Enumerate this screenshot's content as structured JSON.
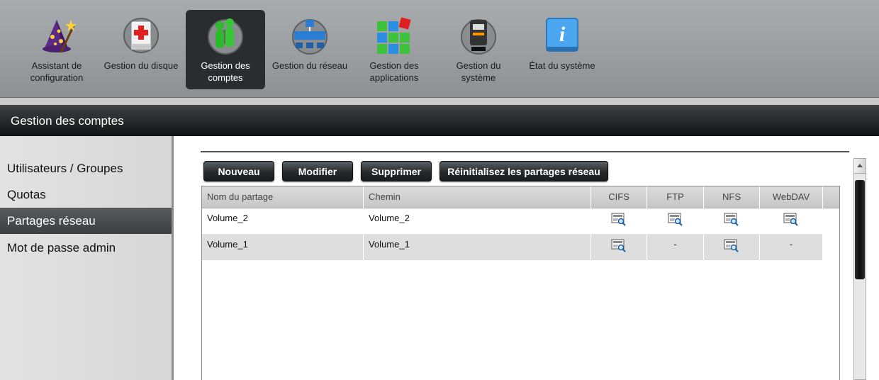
{
  "topnav": [
    {
      "label_lines": [
        "Assistant de",
        "configuration"
      ],
      "icon": "wizard-icon"
    },
    {
      "label_lines": [
        "Gestion du disque"
      ],
      "icon": "disk-icon"
    },
    {
      "label_lines": [
        "Gestion des",
        "comptes"
      ],
      "icon": "accounts-icon"
    },
    {
      "label_lines": [
        "Gestion du réseau"
      ],
      "icon": "network-icon"
    },
    {
      "label_lines": [
        "Gestion des",
        "applications"
      ],
      "icon": "applications-icon"
    },
    {
      "label_lines": [
        "Gestion du",
        "système"
      ],
      "icon": "system-icon"
    },
    {
      "label_lines": [
        "État du système"
      ],
      "icon": "info-icon"
    }
  ],
  "page_title": "Gestion des comptes",
  "sidebar": {
    "items": [
      {
        "label": "Utilisateurs / Groupes"
      },
      {
        "label": "Quotas"
      },
      {
        "label": "Partages réseau"
      },
      {
        "label": "Mot de passe admin"
      }
    ]
  },
  "toolbar": {
    "new_label": "Nouveau",
    "edit_label": "Modifier",
    "delete_label": "Supprimer",
    "reset_label": "Réinitialisez les partages réseau"
  },
  "table": {
    "columns": [
      "Nom du partage",
      "Chemin",
      "CIFS",
      "FTP",
      "NFS",
      "WebDAV"
    ],
    "rows": [
      {
        "name": "Volume_2",
        "path": "Volume_2",
        "cifs": "icon",
        "ftp": "icon",
        "nfs": "icon",
        "webdav": "icon"
      },
      {
        "name": "Volume_1",
        "path": "Volume_1",
        "cifs": "icon",
        "ftp": "-",
        "nfs": "icon",
        "webdav": "-"
      }
    ]
  },
  "colors": {
    "active_nav": "#2a2d30",
    "title_bar": "#1a1c1e",
    "button": "#25292c",
    "sidebar_active": "#4a4d50"
  }
}
